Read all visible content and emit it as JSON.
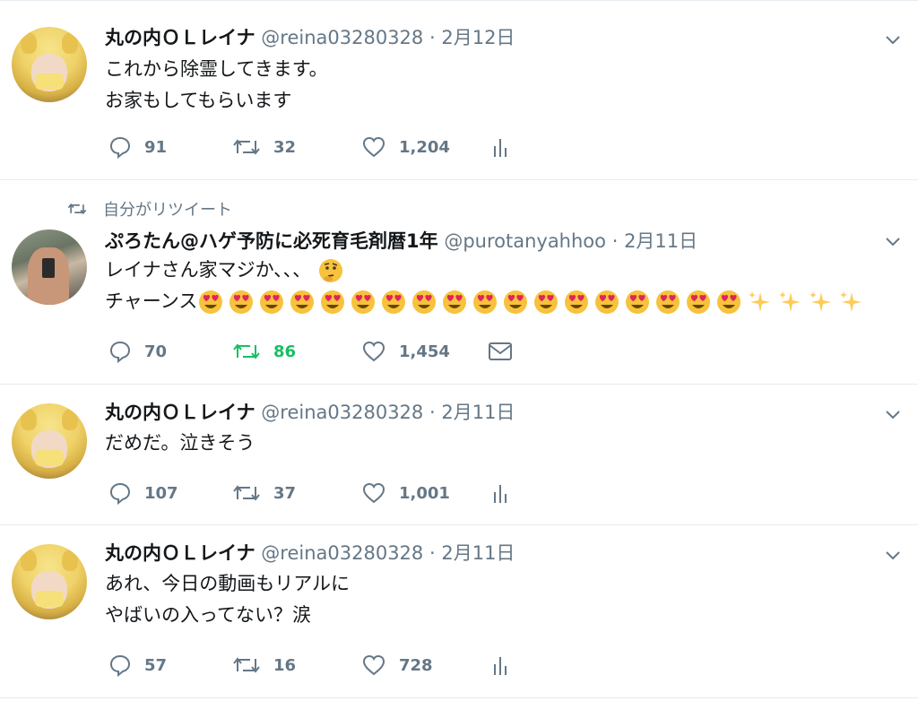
{
  "retweet_note": "自分がリツイート",
  "tweets": [
    {
      "name": "丸の内ＯＬレイナ",
      "handle": "@reina03280328",
      "dot": "·",
      "time": "2月12日",
      "lines": [
        "これから除霊してきます。",
        "お家もしてもらいます"
      ],
      "reply": "91",
      "retweet": "32",
      "like": "1,204",
      "extra_icon": "analytics-icon"
    },
    {
      "name": "ぷろたん@ハゲ予防に必死育毛剤暦1年",
      "handle": "@purotanyahhoo",
      "dot": "·",
      "time": "2月11日",
      "lines": [
        "レイナさん家マジか、、、",
        "チャーンス"
      ],
      "reply": "70",
      "retweet": "86",
      "like": "1,454",
      "extra_icon": "envelope-icon",
      "retweeted": true
    },
    {
      "name": "丸の内ＯＬレイナ",
      "handle": "@reina03280328",
      "dot": "·",
      "time": "2月11日",
      "lines": [
        "だめだ。泣きそう"
      ],
      "reply": "107",
      "retweet": "37",
      "like": "1,001",
      "extra_icon": "analytics-icon"
    },
    {
      "name": "丸の内ＯＬレイナ",
      "handle": "@reina03280328",
      "dot": "·",
      "time": "2月11日",
      "lines": [
        "あれ、今日の動画もリアルに",
        "やばいの入ってない？涙"
      ],
      "reply": "57",
      "retweet": "16",
      "like": "728",
      "extra_icon": "analytics-icon"
    }
  ],
  "colors": {
    "muted": "#657786",
    "retweet_active": "#17bf63",
    "divider": "#e6ecf0"
  }
}
